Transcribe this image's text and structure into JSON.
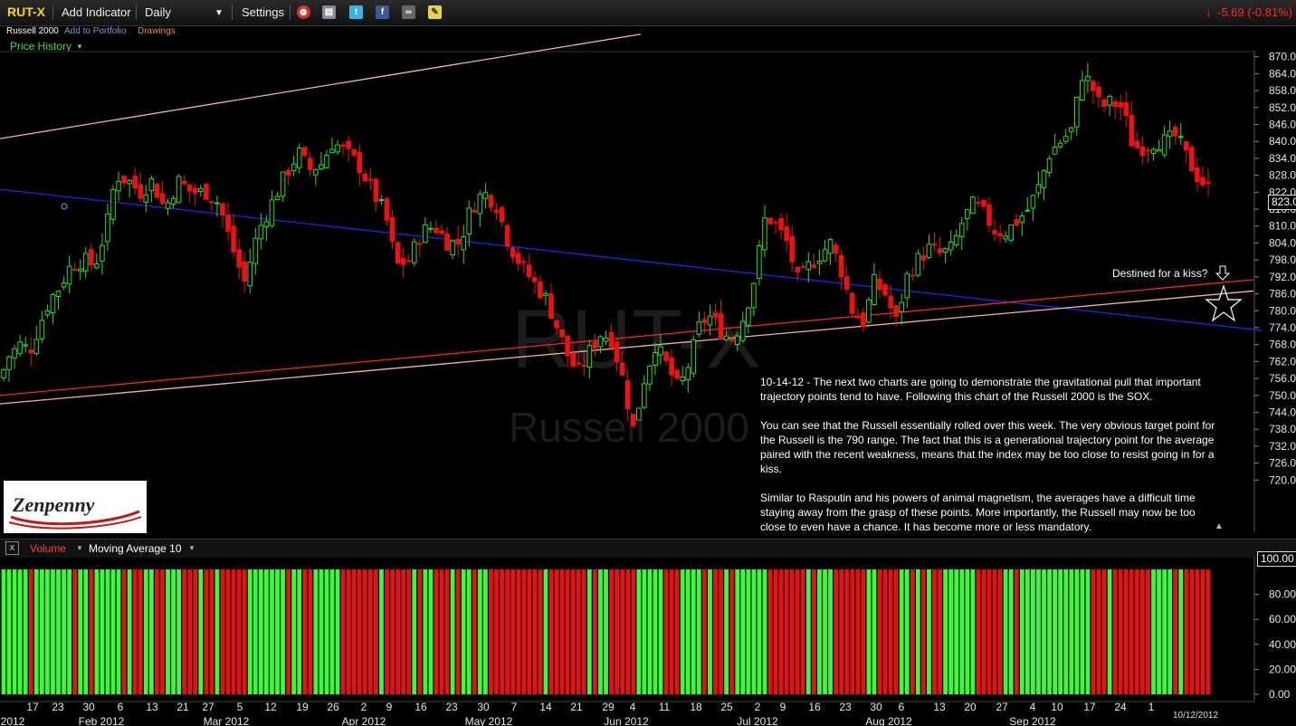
{
  "toolbar": {
    "symbol": "RUT-X",
    "add_indicator": "Add Indicator",
    "interval": "Daily",
    "settings": "Settings",
    "change": "-5.69 (-0.81%)",
    "change_color": "#ff2a2a"
  },
  "subheader": {
    "name": "Russell 2000",
    "add_portfolio": "Add to Portfolio",
    "drawings": "Drawings",
    "price_history": "Price History"
  },
  "watermark": {
    "symbol": "RUT-X",
    "name": "Russell 2000"
  },
  "logo_text": "Zenpenny",
  "annotation": {
    "kiss": "Destined for a kiss?",
    "paragraphs": [
      "10-14-12 - The next two charts are going to demonstrate the gravitational pull that important trajectory points tend to have. Following this chart of the Russell 2000 is the SOX.",
      "You can see that the Russell essentially rolled over this week. The very obvious target point for the Russell is the 790 range. The fact that this is a generational trajectory point for the average paired with the recent weakness, means that the index may be too close to resist going in for a kiss.",
      "Similar to Rasputin and his powers of animal magnetism, the averages have a difficult time staying away from the grasp of these points. More importantly, the Russell may now be too close to even have a chance. It has become more or less mandatory."
    ]
  },
  "volume_panel": {
    "label": "Volume",
    "ma_label": "Moving Average 10",
    "last_badge": "100.00"
  },
  "colors": {
    "up": "#22dd22",
    "down": "#ee1111",
    "trend_blue": "#2020ff",
    "trend_red": "#ff2020",
    "trend_pink": "#ffb0a0"
  },
  "chart_data": {
    "type": "candlestick",
    "title": "RUT-X",
    "ylim": [
      714,
      876
    ],
    "y_ticks": [
      "870.00",
      "864.00",
      "858.00",
      "852.00",
      "846.00",
      "840.00",
      "834.00",
      "828.00",
      "822.00",
      "816.00",
      "810.00",
      "804.00",
      "798.00",
      "792.00",
      "786.00",
      "780.00",
      "774.00",
      "768.00",
      "762.00",
      "756.00",
      "750.00",
      "744.00",
      "738.00",
      "732.00",
      "726.00",
      "720.00"
    ],
    "last_price": "823.09",
    "x_labels": [
      "17",
      "23",
      "30",
      "6",
      "13",
      "21",
      "27",
      "5",
      "12",
      "19",
      "26",
      "2",
      "9",
      "16",
      "23",
      "30",
      "7",
      "14",
      "21",
      "29",
      "4",
      "11",
      "18",
      "25",
      "2",
      "9",
      "16",
      "23",
      "30",
      "6",
      "13",
      "20",
      "27",
      "4",
      "10",
      "17",
      "24",
      "1"
    ],
    "month_labels": [
      "2012",
      "Feb 2012",
      "Mar 2012",
      "Apr 2012",
      "May 2012",
      "Jun 2012",
      "Jul 2012",
      "Aug 2012",
      "Sep 2012"
    ],
    "date_label": "10/12/2012",
    "anchors": [
      [
        0,
        756
      ],
      [
        10,
        764
      ],
      [
        22,
        768
      ],
      [
        33,
        766
      ],
      [
        45,
        776
      ],
      [
        55,
        784
      ],
      [
        65,
        788
      ],
      [
        78,
        796
      ],
      [
        92,
        798
      ],
      [
        105,
        796
      ],
      [
        118,
        810
      ],
      [
        128,
        828
      ],
      [
        142,
        826
      ],
      [
        155,
        822
      ],
      [
        168,
        826
      ],
      [
        182,
        816
      ],
      [
        197,
        826
      ],
      [
        212,
        822
      ],
      [
        228,
        822
      ],
      [
        242,
        818
      ],
      [
        255,
        804
      ],
      [
        270,
        790
      ],
      [
        285,
        808
      ],
      [
        300,
        818
      ],
      [
        315,
        828
      ],
      [
        330,
        836
      ],
      [
        342,
        830
      ],
      [
        355,
        832
      ],
      [
        368,
        840
      ],
      [
        382,
        836
      ],
      [
        396,
        832
      ],
      [
        412,
        822
      ],
      [
        426,
        814
      ],
      [
        438,
        796
      ],
      [
        452,
        798
      ],
      [
        466,
        808
      ],
      [
        480,
        810
      ],
      [
        495,
        804
      ],
      [
        508,
        804
      ],
      [
        520,
        816
      ],
      [
        534,
        822
      ],
      [
        548,
        818
      ],
      [
        562,
        804
      ],
      [
        576,
        796
      ],
      [
        590,
        790
      ],
      [
        604,
        784
      ],
      [
        618,
        772
      ],
      [
        630,
        762
      ],
      [
        640,
        758
      ],
      [
        652,
        766
      ],
      [
        664,
        772
      ],
      [
        676,
        770
      ],
      [
        688,
        756
      ],
      [
        700,
        738
      ],
      [
        712,
        756
      ],
      [
        724,
        768
      ],
      [
        738,
        760
      ],
      [
        750,
        752
      ],
      [
        762,
        762
      ],
      [
        774,
        776
      ],
      [
        786,
        778
      ],
      [
        798,
        772
      ],
      [
        810,
        770
      ],
      [
        822,
        778
      ],
      [
        834,
        792
      ],
      [
        846,
        814
      ],
      [
        858,
        810
      ],
      [
        870,
        804
      ],
      [
        882,
        790
      ],
      [
        894,
        796
      ],
      [
        906,
        800
      ],
      [
        918,
        804
      ],
      [
        930,
        794
      ],
      [
        942,
        780
      ],
      [
        954,
        776
      ],
      [
        966,
        790
      ],
      [
        978,
        786
      ],
      [
        990,
        776
      ],
      [
        1002,
        792
      ],
      [
        1014,
        798
      ],
      [
        1026,
        802
      ],
      [
        1040,
        800
      ],
      [
        1052,
        802
      ],
      [
        1064,
        812
      ],
      [
        1076,
        818
      ],
      [
        1088,
        814
      ],
      [
        1100,
        808
      ],
      [
        1112,
        808
      ],
      [
        1124,
        812
      ],
      [
        1136,
        816
      ],
      [
        1148,
        824
      ],
      [
        1160,
        836
      ],
      [
        1172,
        840
      ],
      [
        1184,
        844
      ],
      [
        1196,
        864
      ],
      [
        1206,
        860
      ],
      [
        1216,
        852
      ],
      [
        1228,
        854
      ],
      [
        1240,
        852
      ],
      [
        1252,
        838
      ],
      [
        1264,
        838
      ],
      [
        1276,
        840
      ],
      [
        1288,
        840
      ],
      [
        1300,
        842
      ],
      [
        1312,
        834
      ],
      [
        1322,
        828
      ],
      [
        1336,
        823
      ]
    ],
    "trendlines": [
      {
        "color": "trend_pink",
        "points": [
          [
            0,
            841
          ],
          [
            708,
            878
          ]
        ]
      },
      {
        "color": "trend_blue",
        "points": [
          [
            0,
            823
          ],
          [
            1395,
            773
          ]
        ]
      },
      {
        "color": "trend_red",
        "points": [
          [
            0,
            750
          ],
          [
            1385,
            791
          ]
        ]
      },
      {
        "color": "trend_pink",
        "points": [
          [
            0,
            747
          ],
          [
            1385,
            787
          ]
        ]
      }
    ],
    "volume": {
      "ylim": [
        0,
        108
      ],
      "y_ticks": [
        "80.00",
        "60.00",
        "40.00",
        "20.00",
        "0.00"
      ]
    }
  }
}
